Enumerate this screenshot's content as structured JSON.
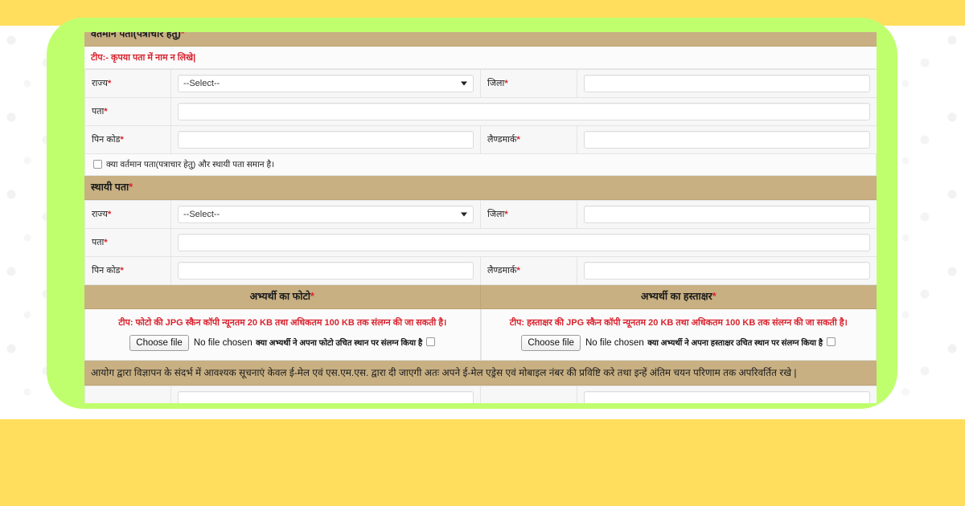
{
  "theme": {
    "outer_bg": "#FFDE5E",
    "frame_green": "#BFFF6E",
    "band_tan": "#C8B083",
    "required_red": "#d9232e"
  },
  "form": {
    "current_address": {
      "band_title": "वर्तमान पता(पत्राचार हेतु)",
      "band_required": "*",
      "note": "टीप:- कृपया पता में नाम न लिखे|",
      "rows": [
        {
          "label_left": "राज्य",
          "req_left": "*",
          "control_left": "select",
          "select_value": "--Select--",
          "label_right": "जिला",
          "req_right": "*",
          "control_right": "input"
        },
        {
          "label_left": "पता",
          "req_left": "*",
          "control_left": "input-wide"
        },
        {
          "label_left": "पिन कोड",
          "req_left": "*",
          "control_left": "input",
          "label_right": "लैण्डमार्क",
          "req_right": "*",
          "control_right": "input"
        }
      ],
      "same_address_checkbox_label": "क्या वर्तमान पता(पत्राचार हेतु) और स्थायी पता समान है।",
      "same_address_checked": false
    },
    "permanent_address": {
      "band_title": "स्थायी पता",
      "band_required": "*",
      "rows": [
        {
          "label_left": "राज्य",
          "req_left": "*",
          "control_left": "select",
          "select_value": "--Select--",
          "label_right": "जिला",
          "req_right": "*",
          "control_right": "input"
        },
        {
          "label_left": "पता",
          "req_left": "*",
          "control_left": "input-wide"
        },
        {
          "label_left": "पिन कोड",
          "req_left": "*",
          "control_left": "input",
          "label_right": "लैण्डमार्क",
          "req_right": "*",
          "control_right": "input"
        }
      ]
    },
    "photo": {
      "band_title": "अभ्यर्थी का फोटो",
      "band_required": "*",
      "note": "टीप: फोटो की JPG स्कैन कॉपी न्यूनतम 20 KB तथा अधिकतम 100 KB तक संलग्न की जा सकती है।",
      "file_button_label": "Choose file",
      "file_status": "No file chosen",
      "confirm_label": "क्या अभ्यर्थी ने अपना फोटो उचित स्थान पर संलग्न किया है",
      "confirm_checked": false
    },
    "signature": {
      "band_title": "अभ्यर्थी का हस्ताक्षर",
      "band_required": "*",
      "note": "टीप: हस्ताक्षर की JPG स्कैन कॉपी न्यूनतम 20 KB तथा अधिकतम 100 KB तक संलग्न की जा सकती है।",
      "file_button_label": "Choose file",
      "file_status": "No file chosen",
      "confirm_label": "क्या अभ्यर्थी ने अपना हस्ताक्षर उचित स्थान पर संलग्न किया है",
      "confirm_checked": false
    },
    "contact_notice": {
      "text": "आयोग द्वारा विज्ञापन के संदर्भ में आवश्यक सूचनाएं केवल ई-मेल एवं एस.एम.एस. द्वारा दी जाएगी अतः अपने ई-मेल एड्रेस एवं मोबाइल नंबर की प्रविष्टि करे तथा इन्हें अंतिम चयन परिणाम तक अपरिवर्तित रखे |"
    }
  }
}
